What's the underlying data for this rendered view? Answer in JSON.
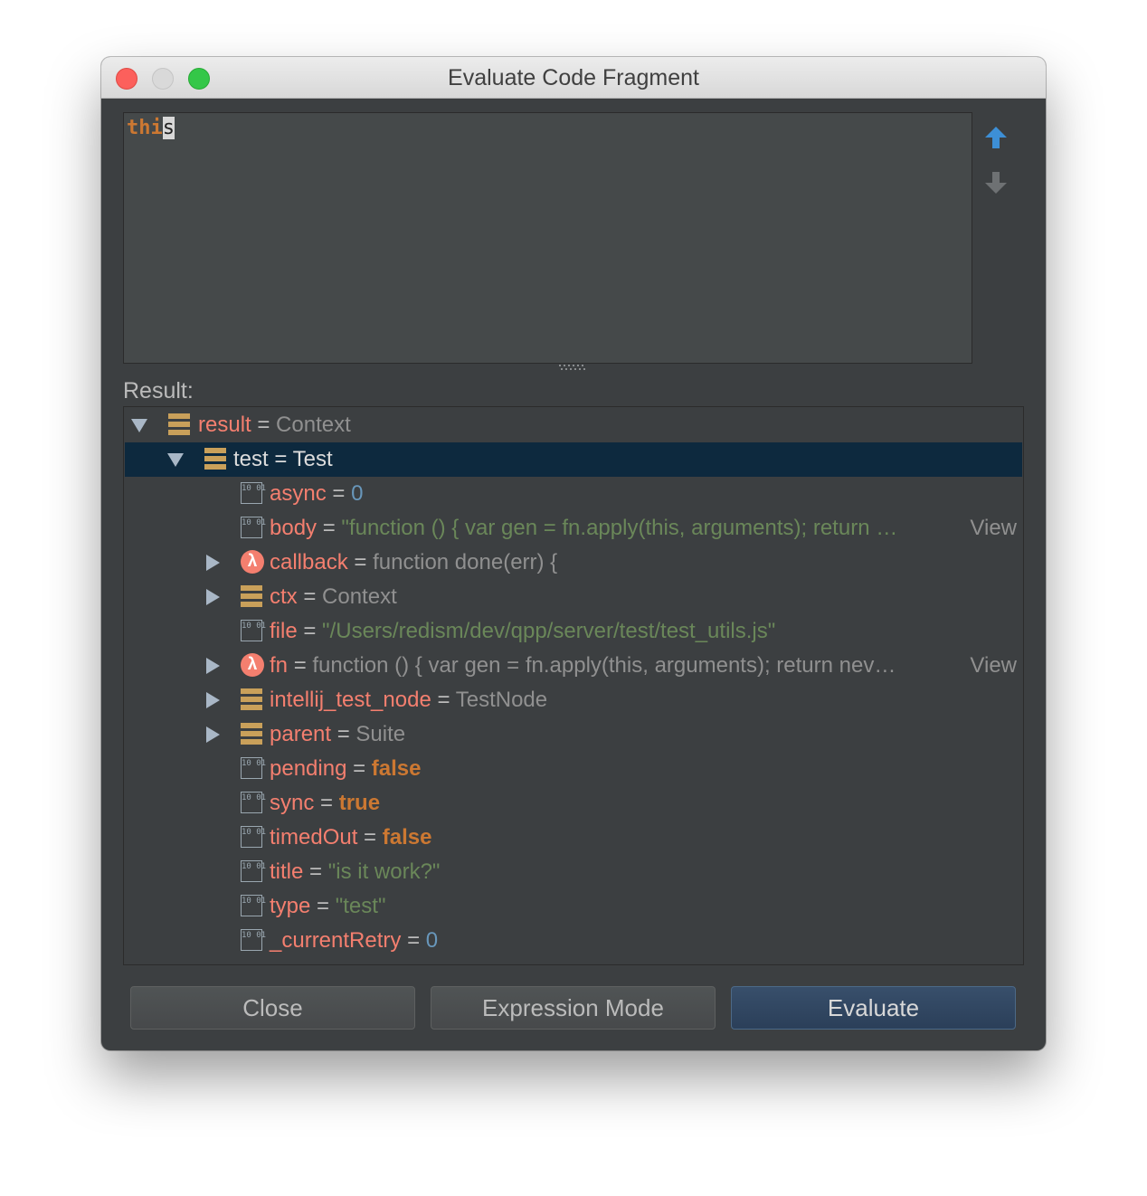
{
  "window": {
    "title": "Evaluate Code Fragment"
  },
  "editor": {
    "code_before": "thi",
    "code_selected": "s"
  },
  "result_label": "Result:",
  "tree": {
    "root": {
      "name": "result",
      "eq": "=",
      "value": "Context"
    },
    "test": {
      "name": "test",
      "eq": "=",
      "value": "Test"
    },
    "children": [
      {
        "name": "async",
        "eq": "=",
        "value": "0"
      },
      {
        "name": "body",
        "eq": "=",
        "value": "\"function () { var gen = fn.apply(this, arguments); return …",
        "link": "View"
      },
      {
        "name": "callback",
        "eq": "=",
        "value": "function done(err) {"
      },
      {
        "name": "ctx",
        "eq": "=",
        "value": "Context"
      },
      {
        "name": "file",
        "eq": "=",
        "value": "\"/Users/redism/dev/qpp/server/test/test_utils.js\""
      },
      {
        "name": "fn",
        "eq": "=",
        "value": "function () { var gen = fn.apply(this, arguments); return nev…",
        "link": "View"
      },
      {
        "name": "intellij_test_node",
        "eq": "=",
        "value": "TestNode"
      },
      {
        "name": "parent",
        "eq": "=",
        "value": "Suite"
      },
      {
        "name": "pending",
        "eq": "=",
        "value": "false"
      },
      {
        "name": "sync",
        "eq": "=",
        "value": "true"
      },
      {
        "name": "timedOut",
        "eq": "=",
        "value": "false"
      },
      {
        "name": "title",
        "eq": "=",
        "value": "\"is it work?\""
      },
      {
        "name": "type",
        "eq": "=",
        "value": "\"test\""
      },
      {
        "name": "_currentRetry",
        "eq": "=",
        "value": "0"
      }
    ]
  },
  "icons": {
    "history_up": "arrow-up-icon",
    "history_down": "arrow-down-icon",
    "object": "object-icon",
    "primitive": "primitive-icon",
    "function": "lambda-icon",
    "primitive_glyph": "10 01",
    "function_glyph": "λ"
  },
  "buttons": {
    "close": "Close",
    "mode": "Expression Mode",
    "evaluate": "Evaluate"
  },
  "colors": {
    "name": "#f47f6f",
    "string": "#6a8759",
    "number": "#6897bb",
    "keyword": "#cc7832",
    "selection": "#0d293e",
    "evaluate_button": "#2b3f59"
  }
}
